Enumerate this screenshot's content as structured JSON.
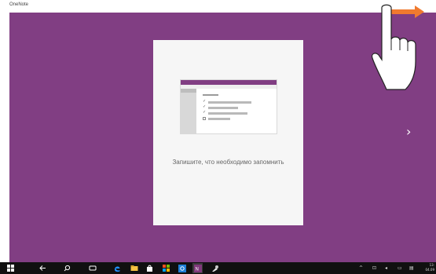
{
  "app": {
    "title": "OneNote"
  },
  "card": {
    "caption": "Запишите, что необходимо запомнить"
  },
  "icons": {
    "next": "chevron-right-icon",
    "gesture": "swipe-right-hand-icon"
  },
  "colors": {
    "background_purple": "#813e83",
    "gesture_arrow": "#f07a2f",
    "taskbar": "#101010"
  },
  "taskbar": {
    "items": [
      "start",
      "back",
      "search",
      "task-view",
      "edge",
      "file-explorer",
      "store",
      "photos",
      "outlook",
      "onenote",
      "paint"
    ],
    "clock": {
      "time": "13:",
      "date": "04.09"
    }
  }
}
